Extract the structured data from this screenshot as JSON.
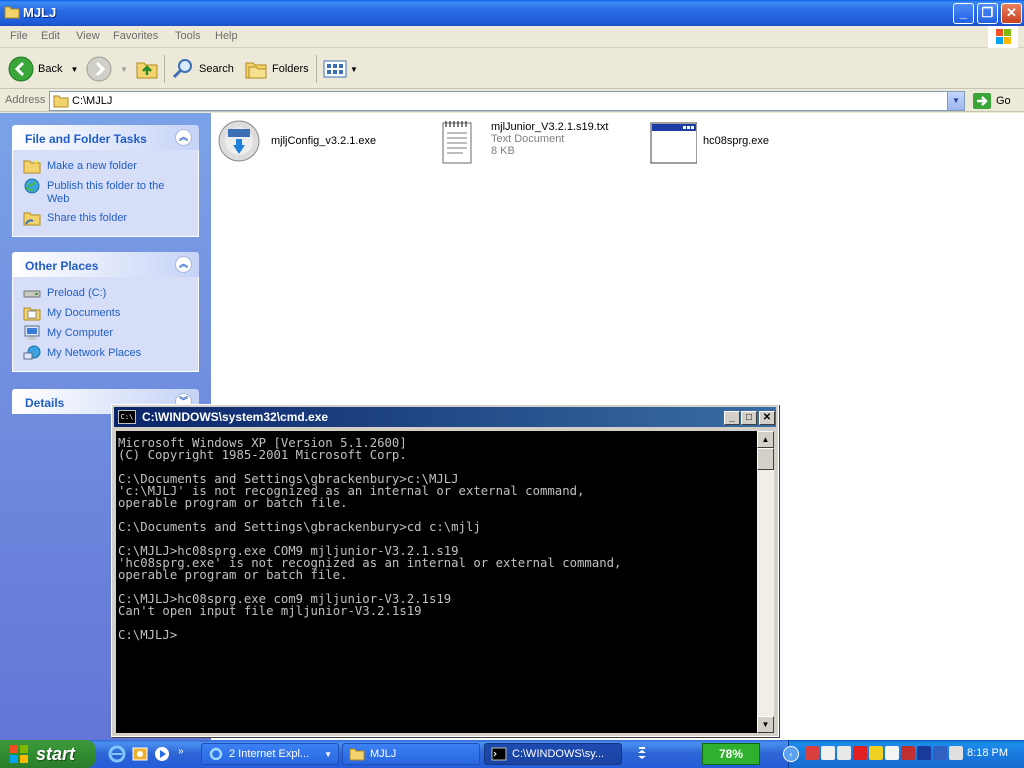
{
  "explorer": {
    "title": "MJLJ",
    "menu": [
      "File",
      "Edit",
      "View",
      "Favorites",
      "Tools",
      "Help"
    ],
    "toolbar": {
      "back": "Back",
      "search": "Search",
      "folders": "Folders"
    },
    "address": {
      "label": "Address",
      "value": "C:\\MJLJ",
      "go": "Go"
    },
    "tasks": {
      "title": "File and Folder Tasks",
      "items": [
        "Make a new folder",
        "Publish this folder to the",
        "Web",
        "Share this folder"
      ]
    },
    "places": {
      "title": "Other Places",
      "items": [
        "Preload (C:)",
        "My Documents",
        "My Computer",
        "My Network Places"
      ]
    },
    "details": {
      "title": "Details"
    },
    "files": [
      {
        "name": "mjljConfig_v3.2.1.exe"
      },
      {
        "name": "mjlJunior_V3.2.1.s19.txt",
        "type": "Text Document",
        "size": "8 KB"
      },
      {
        "name": "hc08sprg.exe"
      }
    ]
  },
  "cmd": {
    "title": "C:\\WINDOWS\\system32\\cmd.exe",
    "lines": [
      "Microsoft Windows XP [Version 5.1.2600]",
      "(C) Copyright 1985-2001 Microsoft Corp.",
      "",
      "C:\\Documents and Settings\\gbrackenbury>c:\\MJLJ",
      "'c:\\MJLJ' is not recognized as an internal or external command,",
      "operable program or batch file.",
      "",
      "C:\\Documents and Settings\\gbrackenbury>cd c:\\mjlj",
      "",
      "C:\\MJLJ>hc08sprg.exe COM9 mjljunior-V3.2.1.s19",
      "'hc08sprg.exe' is not recognized as an internal or external command,",
      "operable program or batch file.",
      "",
      "C:\\MJLJ>hc08sprg.exe com9 mjljunior-V3.2.1s19",
      "Can't open input file mjljunior-V3.2.1s19",
      "",
      "C:\\MJLJ>"
    ]
  },
  "taskbar": {
    "start": "start",
    "tasks": [
      "2 Internet Expl...",
      "MJLJ",
      "C:\\WINDOWS\\sy..."
    ],
    "battery": "78%",
    "clock": "8:18 PM"
  },
  "colors": {
    "xp_blue": "#245DDA",
    "link_blue": "#215DC6",
    "start_green": "#2F8A2F"
  }
}
